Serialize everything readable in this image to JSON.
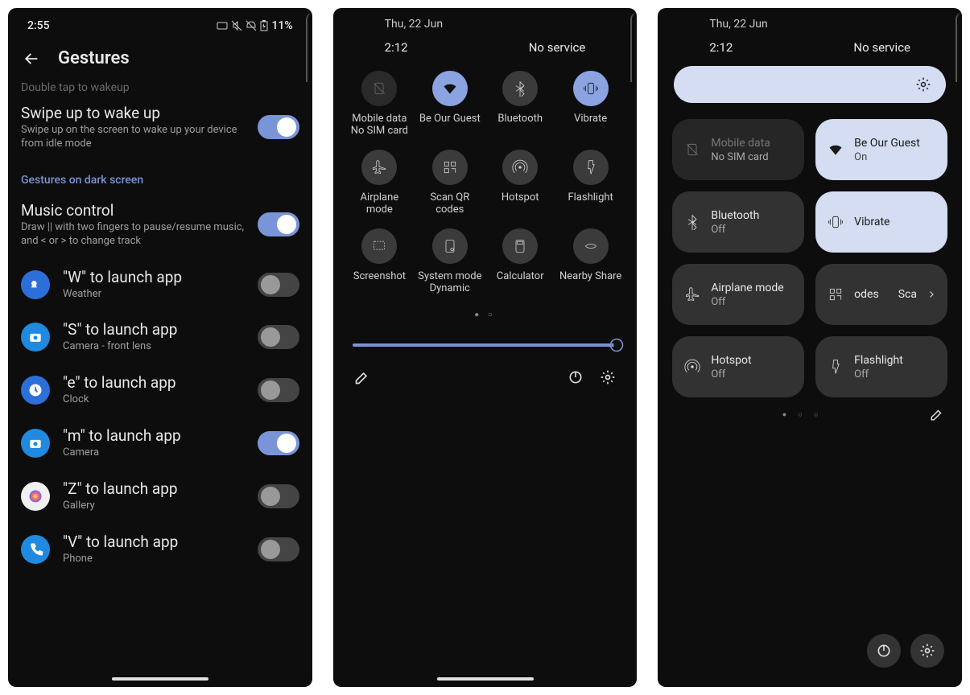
{
  "screen1": {
    "status": {
      "time": "2:55",
      "battery": "11%"
    },
    "title": "Gestures",
    "cutoff": "Double tap to wakeup",
    "swipe": {
      "title": "Swipe up to wake up",
      "desc": "Swipe up on the screen to wake up your device from idle mode",
      "on": true
    },
    "section": "Gestures on dark screen",
    "music": {
      "title": "Music control",
      "desc": "Draw || with two fingers to pause/resume music, and < or > to change track",
      "on": true
    },
    "items": [
      {
        "title": "\"W\" to launch app",
        "sub": "Weather",
        "on": false,
        "color": "#2d6fd8"
      },
      {
        "title": "\"S\" to launch app",
        "sub": "Camera - front lens",
        "on": false,
        "color": "#1f8ae0"
      },
      {
        "title": "\"e\" to launch app",
        "sub": "Clock",
        "on": false,
        "color": "#2d6fd8"
      },
      {
        "title": "\"m\" to launch app",
        "sub": "Camera",
        "on": true,
        "color": "#1f8ae0"
      },
      {
        "title": "\"Z\" to launch app",
        "sub": "Gallery",
        "on": false,
        "color": "#f0f0f0"
      },
      {
        "title": "\"V\" to launch app",
        "sub": "Phone",
        "on": false,
        "color": "#1f8ae0"
      }
    ]
  },
  "screen2": {
    "date": "Thu, 22 Jun",
    "time": "2:12",
    "service": "No service",
    "tiles": [
      {
        "label": "Mobile data",
        "sub": "No SIM card",
        "state": "dim"
      },
      {
        "label": "Be Our Guest",
        "sub": "",
        "state": "active"
      },
      {
        "label": "Bluetooth",
        "sub": "",
        "state": "off"
      },
      {
        "label": "Vibrate",
        "sub": "",
        "state": "active"
      },
      {
        "label": "Airplane mode",
        "sub": "",
        "state": "off"
      },
      {
        "label": "Scan QR codes",
        "sub": "",
        "state": "off"
      },
      {
        "label": "Hotspot",
        "sub": "",
        "state": "off"
      },
      {
        "label": "Flashlight",
        "sub": "",
        "state": "off"
      },
      {
        "label": "Screenshot",
        "sub": "",
        "state": "off"
      },
      {
        "label": "System mode",
        "sub": "Dynamic",
        "state": "off"
      },
      {
        "label": "Calculator",
        "sub": "",
        "state": "off"
      },
      {
        "label": "Nearby Share",
        "sub": "",
        "state": "off"
      }
    ]
  },
  "screen3": {
    "date": "Thu, 22 Jun",
    "time": "2:12",
    "service": "No service",
    "tiles": [
      {
        "label": "Mobile data",
        "sub": "No SIM card",
        "state": "dim"
      },
      {
        "label": "Be Our Guest",
        "sub": "On",
        "state": "active"
      },
      {
        "label": "Bluetooth",
        "sub": "Off",
        "state": "off"
      },
      {
        "label": "Vibrate",
        "sub": "",
        "state": "active"
      },
      {
        "label": "Airplane mode",
        "sub": "Off",
        "state": "off"
      },
      {
        "label": "odes",
        "sub": "Sca",
        "state": "off",
        "partial": true
      },
      {
        "label": "Hotspot",
        "sub": "Off",
        "state": "off"
      },
      {
        "label": "Flashlight",
        "sub": "Off",
        "state": "off"
      }
    ]
  }
}
